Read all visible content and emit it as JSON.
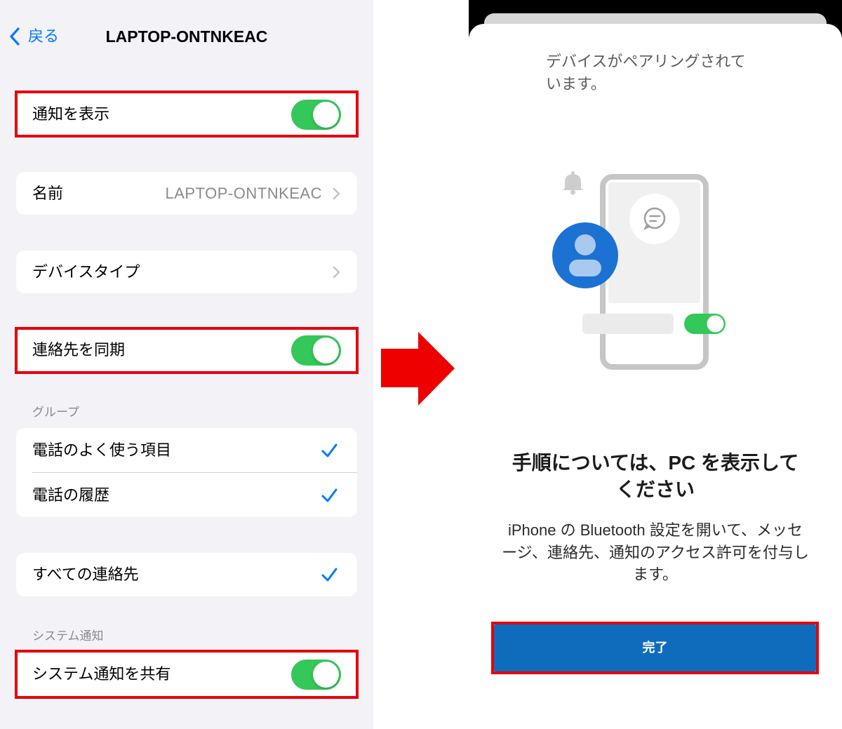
{
  "colors": {
    "ios-background": "#f2f2f7",
    "ios-blue": "#007aff",
    "toggle-green": "#34c759",
    "highlight-red": "#e5000a",
    "arrow-red": "#ee0000",
    "button-blue": "#0f6cbd",
    "avatar-blue": "#1b72d2"
  },
  "settings_screen": {
    "nav": {
      "back_icon": "chevron-left-icon",
      "back_label": "戻る",
      "title": "LAPTOP-ONTNKEAC"
    },
    "show_notifications": {
      "label": "通知を表示",
      "toggle_on": true,
      "highlighted": true
    },
    "name": {
      "label": "名前",
      "value": "LAPTOP-ONTNKEAC",
      "icon": "chevron-right-icon"
    },
    "device_type": {
      "label": "デバイスタイプ",
      "icon": "chevron-right-icon"
    },
    "sync_contacts": {
      "label": "連絡先を同期",
      "toggle_on": true,
      "highlighted": true
    },
    "groups": {
      "header": "グループ",
      "items": [
        {
          "label": "電話のよく使う項目",
          "checked": true,
          "icon": "checkmark-icon"
        },
        {
          "label": "電話の履歴",
          "checked": true,
          "icon": "checkmark-icon"
        }
      ]
    },
    "all_contacts": {
      "label": "すべての連絡先",
      "checked": true,
      "icon": "checkmark-icon"
    },
    "system_notifications": {
      "header": "システム通知",
      "share_label": "システム通知を共有",
      "toggle_on": true,
      "highlighted": true
    }
  },
  "transition_arrow": {
    "icon": "right-arrow-icon"
  },
  "pairing_screen": {
    "status_lines": [
      "デバイスがペアリングされて",
      "います。"
    ],
    "illustration_icons": [
      "bell-icon",
      "phone-icon",
      "chat-bubble-icon",
      "person-avatar-icon",
      "toggle-switch-icon"
    ],
    "illustration_toggle_on": true,
    "heading_lines": [
      "手順については、PC を表示して",
      "ください"
    ],
    "body_lines": [
      "iPhone の Bluetooth 設定を開いて、メッセ",
      "ージ、連絡先、通知のアクセス許可を付与し",
      "ます。"
    ],
    "done_button_label": "完了",
    "done_button_highlighted": true
  }
}
